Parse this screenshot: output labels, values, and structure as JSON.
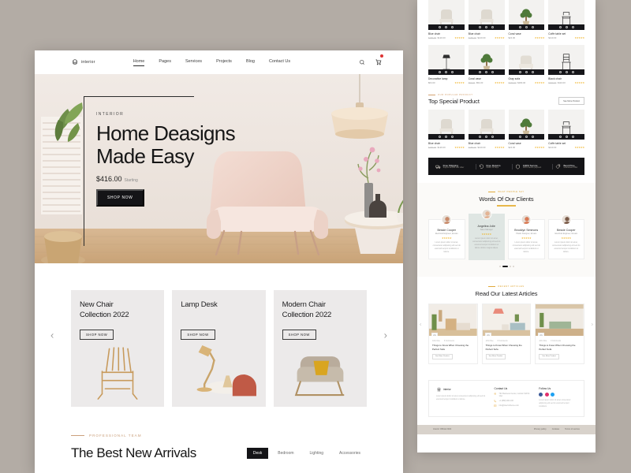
{
  "home": {
    "brand": {
      "name": "interior",
      "logo_icon": "chair-logo-icon"
    },
    "nav": {
      "links": [
        {
          "label": "Home",
          "active": true
        },
        {
          "label": "Pages",
          "active": false
        },
        {
          "label": "Services",
          "active": false
        },
        {
          "label": "Projects",
          "active": false
        },
        {
          "label": "Blog",
          "active": false
        },
        {
          "label": "Contact Us",
          "active": false
        }
      ],
      "search_icon": "search-icon",
      "cart_icon": "cart-icon"
    },
    "hero": {
      "eyebrow": "INTERIOR",
      "title_line1": "Home Deasigns",
      "title_line2": "Made Easy",
      "price": "$416.00",
      "price_note": "Starting",
      "cta": "SHOP NOW"
    },
    "categories": [
      {
        "title_line1": "New Chair",
        "title_line2": "Collection 2022",
        "cta": "SHOP NOW"
      },
      {
        "title_line1": "Lamp Desk",
        "title_line2": "",
        "cta": "SHOP NOW"
      },
      {
        "title_line1": "Modern Chair",
        "title_line2": "Collection 2022",
        "cta": "SHOP NOW"
      }
    ],
    "carousel": {
      "prev": "‹",
      "next": "›"
    },
    "arrivals": {
      "eyebrow": "PROFESSIONAL TEAM",
      "title": "The Best New Arrivals",
      "tabs": [
        {
          "label": "Desk",
          "active": true
        },
        {
          "label": "Bedroom",
          "active": false
        },
        {
          "label": "Lighting",
          "active": false
        },
        {
          "label": "Accessories",
          "active": false
        }
      ]
    }
  },
  "long": {
    "grid_top": [
      {
        "name": "Blue chair",
        "old_price": "$180.00",
        "price": "$120.00",
        "stars": "★★★★★"
      },
      {
        "name": "Blue chair",
        "old_price": "$180.00",
        "price": "$120.00",
        "stars": "★★★★★"
      },
      {
        "name": "Coral vase",
        "old_price": "",
        "price": "$24.00",
        "stars": "★★★★★"
      },
      {
        "name": "Coffe table set",
        "old_price": "",
        "price": "$210.00",
        "stars": "★★★★★"
      }
    ],
    "grid_bottom": [
      {
        "name": "Decorative lamp",
        "old_price": "",
        "price": "$64.00",
        "stars": "★★★★★"
      },
      {
        "name": "Coral vase",
        "old_price": "$90.00",
        "price": "$54.00",
        "stars": "★★★★★"
      },
      {
        "name": "Gray sofa",
        "old_price": "$340.00",
        "price": "$280.00",
        "stars": "★★★★★"
      },
      {
        "name": "Black chair",
        "old_price": "$150.00",
        "price": "$110.00",
        "stars": "★★★★★"
      }
    ],
    "special": {
      "eyebrow": "OUR POPULAR PRODUCT",
      "title": "Top Special Product",
      "button": "See More Product",
      "items": [
        {
          "name": "Blue chair",
          "old_price": "$180.00",
          "price": "$120.00",
          "stars": "★★★★★"
        },
        {
          "name": "Blue chair",
          "old_price": "$180.00",
          "price": "$120.00",
          "stars": "★★★★★"
        },
        {
          "name": "Coral vase",
          "old_price": "",
          "price": "$24.00",
          "stars": "★★★★★"
        },
        {
          "name": "Coffe table set",
          "old_price": "",
          "price": "$210.00",
          "stars": "★★★★★"
        }
      ]
    },
    "features": [
      {
        "icon": "truck-icon",
        "title": "Free Shipping",
        "sub": "Support all $50 over order"
      },
      {
        "icon": "returns-icon",
        "title": "Free Returns",
        "sub": "Within 30 Days"
      },
      {
        "icon": "secure-icon",
        "title": "100% Secure",
        "sub": "100% Secure payment"
      },
      {
        "icon": "price-tag-icon",
        "title": "Best Price",
        "sub": "Guaranteed Offer"
      }
    ],
    "clients": {
      "eyebrow": "WHAT PEOPLE SAY",
      "title": "Words Of Our Clients",
      "items": [
        {
          "name": "Bessie Cooper",
          "role": "Electrical Engineer, Envato",
          "stars": "★★★★★",
          "text": "Lorem ipsum dolor sit amet, consectetur adipiscing elit sed do eiusmod tempor incididunt ut labore.",
          "active": false
        },
        {
          "name": "Angelina Jolie",
          "role": "Sales Manager",
          "stars": "★★★★★",
          "text": "Lorem ipsum dolor sit amet, consectetur adipiscing elit sed do eiusmod tempor incididunt ut labore dolore magna aliqua.",
          "active": true
        },
        {
          "name": "Brooklyn Simmons",
          "role": "Plastic Designer, Envato",
          "stars": "★★★★★",
          "text": "Lorem ipsum dolor sit amet, consectetur adipiscing elit sed do eiusmod tempor incididunt ut labore.",
          "active": false
        },
        {
          "name": "Bessie Cooper",
          "role": "Electrical Engineer, Envato",
          "stars": "★★★★★",
          "text": "Lorem ipsum dolor sit amet, consectetur adipiscing elit sed do eiusmod tempor incididunt ut labore.",
          "active": false
        }
      ]
    },
    "articles": {
      "eyebrow": "RECENT ARTICLES",
      "title": "Read Our Latest Articles",
      "prev": "‹",
      "next": "›",
      "items": [
        {
          "author": "John Doe",
          "comments": "0 Comments",
          "title": "Things to Know When Choosing the Perfect Sofa",
          "cta": "See More Product"
        },
        {
          "author": "John Doe",
          "comments": "0 Comments",
          "title": "Things to Know When Choosing the Perfect Sofa",
          "cta": "See More Product"
        },
        {
          "author": "John Doe",
          "comments": "0 Comments",
          "title": "Things to Know When Choosing the Perfect Sofa",
          "cta": "See More Product"
        }
      ]
    },
    "footer": {
      "brand": "interior",
      "about": "Lorem ipsum dolor sit amet consectetur adipiscing elit sed do eiusmod tempor incididunt ut labore.",
      "contact_heading": "Contact Us",
      "contact": [
        {
          "icon": "location-icon",
          "text": "721 Business Center, London SW1A 1AA"
        },
        {
          "icon": "phone-icon",
          "text": "+1 (888) 000-100"
        },
        {
          "icon": "mail-icon",
          "text": "info@interiortheme.com"
        }
      ],
      "follow_heading": "Follow Us",
      "follow_text": "Lorem ipsum dolor sit amet consectetur adipiscing elit sed do eiusmod tempor incididunt.",
      "socials": [
        "facebook-icon",
        "instagram-icon",
        "twitter-icon"
      ],
      "copyright": "Interior Official 2022",
      "links": [
        "Privacy policy",
        "Cookies",
        "Terms of service"
      ]
    }
  },
  "colors": {
    "accent_gold": "#e0a93a",
    "accent_tan": "#cba07c",
    "dark": "#141417",
    "page_bg": "#b3aca5"
  }
}
